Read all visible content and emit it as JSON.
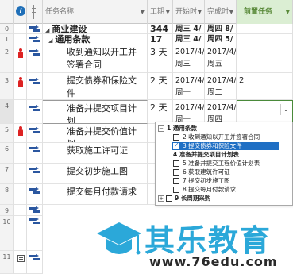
{
  "columns": {
    "name": "任务名称",
    "duration": "工期",
    "start": "开始时",
    "finish": "完成时",
    "predecessors": "前置任务"
  },
  "rows": [
    {
      "id": "0",
      "name": "商业建设",
      "duration": "344 天",
      "start": "周三 4/",
      "finish": "周四 8/",
      "pred": ""
    },
    {
      "id": "1",
      "name": "通用条款",
      "duration": "17 天",
      "start": "周三 4/",
      "finish": "周四 5/",
      "pred": ""
    },
    {
      "id": "2",
      "name": "收到通知以开工并签署合同",
      "duration": "3 天",
      "start": "2017/4/ 周三",
      "finish": "2017/4/ 周五",
      "pred": ""
    },
    {
      "id": "3",
      "name": "提交债券和保险文件",
      "duration": "2 天",
      "start": "2017/4/ 周一",
      "finish": "2017/4/ 周二",
      "pred": "2"
    },
    {
      "id": "4",
      "name": "准备并提交项目计划",
      "duration": "2 天",
      "start": "2017/4/ 周一",
      "finish": "2017/4/ 周四",
      "pred": ""
    },
    {
      "id": "5",
      "name": "准备并提交价值计划",
      "duration": "",
      "start": "",
      "finish": "",
      "pred": ""
    },
    {
      "id": "6",
      "name": "获取施工许可证",
      "duration": "",
      "start": "",
      "finish": "",
      "pred": ""
    },
    {
      "id": "7",
      "name": "提交初步施工图",
      "duration": "",
      "start": "",
      "finish": "",
      "pred": ""
    },
    {
      "id": "8",
      "name": "提交每月付款请求",
      "duration": "",
      "start": "",
      "finish": "",
      "pred": ""
    },
    {
      "id": "9",
      "name": "",
      "duration": "",
      "start": "",
      "finish": "",
      "pred": ""
    },
    {
      "id": "10",
      "name": "",
      "duration": "",
      "start": "",
      "finish": "",
      "pred": ""
    },
    {
      "id": "11",
      "name": "",
      "duration": "",
      "start": "",
      "finish": "",
      "pred": ""
    }
  ],
  "dropdown": {
    "items": [
      {
        "label": "1 通用条款",
        "checked": false,
        "highlighted": false
      },
      {
        "label": "2 收到通知以开工并签署合同",
        "checked": false,
        "highlighted": false
      },
      {
        "label": "3 提交债券和保险文件",
        "checked": true,
        "highlighted": true
      },
      {
        "label": "4 准备并提交项目计划表",
        "checked": false,
        "highlighted": false
      },
      {
        "label": "5 准备并提交工程价值计划表",
        "checked": false,
        "highlighted": false
      },
      {
        "label": "6 获取建筑许可证",
        "checked": false,
        "highlighted": false
      },
      {
        "label": "7 提交初步施工图",
        "checked": false,
        "highlighted": false
      },
      {
        "label": "8 提交每月付款请求",
        "checked": false,
        "highlighted": false
      },
      {
        "label": "9 长周期采购",
        "checked": false,
        "highlighted": false
      }
    ]
  },
  "watermark": {
    "brand": "其乐教育",
    "url": "www.76edu.com"
  }
}
